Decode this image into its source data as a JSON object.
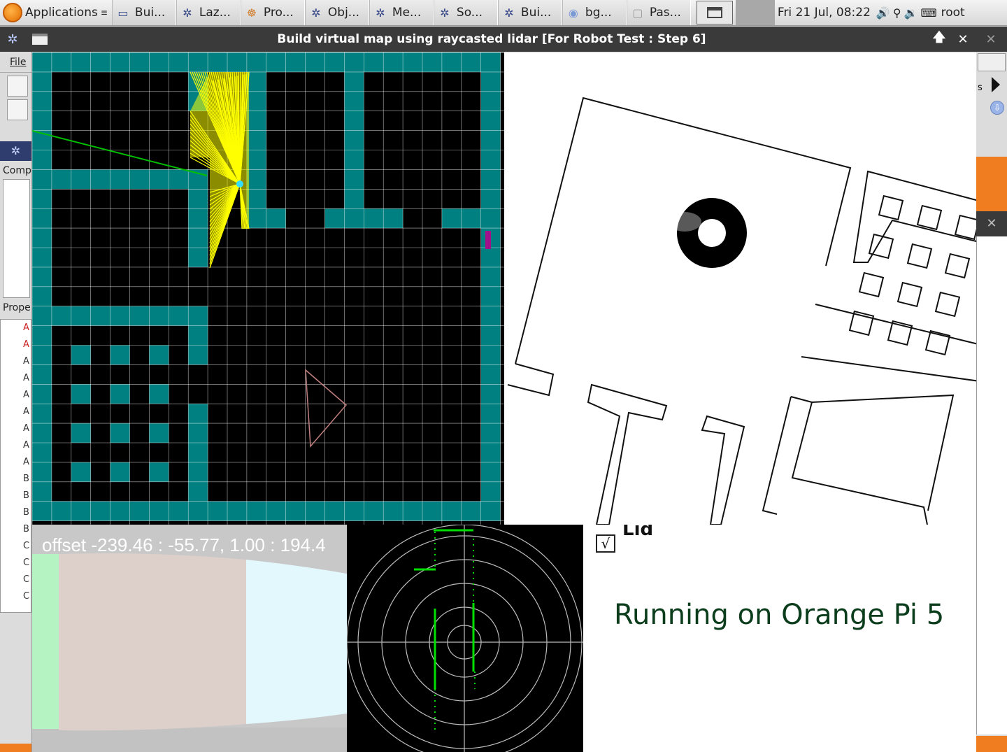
{
  "taskbar": {
    "apps_label": "Applications",
    "tasks": [
      {
        "label": "Bui..."
      },
      {
        "label": "Laz..."
      },
      {
        "label": "Pro..."
      },
      {
        "label": "Obj..."
      },
      {
        "label": "Me..."
      },
      {
        "label": "So..."
      },
      {
        "label": "Bui..."
      },
      {
        "label": "bg..."
      },
      {
        "label": "Pas..."
      }
    ],
    "clock": "Fri 21 Jul, 08:22",
    "user": "root"
  },
  "window": {
    "title": "Build virtual map using raycasted lidar [For Robot Test : Step 6]"
  },
  "ide": {
    "file_menu": "File",
    "components_label": "Comp",
    "properties_label": "Prope",
    "property_rows": [
      "A",
      "A",
      "A",
      "A",
      "A",
      "A",
      "A",
      "A",
      "A",
      "B",
      "B",
      "B",
      "B",
      "C",
      "C",
      "C",
      "C"
    ]
  },
  "right_strip": {
    "small_label": "s"
  },
  "camera": {
    "offset_text": "offset -239.46 : -55.77, 1.00 : 194.4"
  },
  "info": {
    "checkbox_mark": "√",
    "lidar_label": "Lid",
    "running_text": "Running on Orange Pi 5"
  },
  "colors": {
    "wall": "#008080",
    "floor": "#000000",
    "grid_line": "#ffffff",
    "lidar_rays": "#ffff00",
    "radar_points": "#00ff00",
    "running_text": "#0b3d1c",
    "accent_orange": "#f07d1f"
  }
}
